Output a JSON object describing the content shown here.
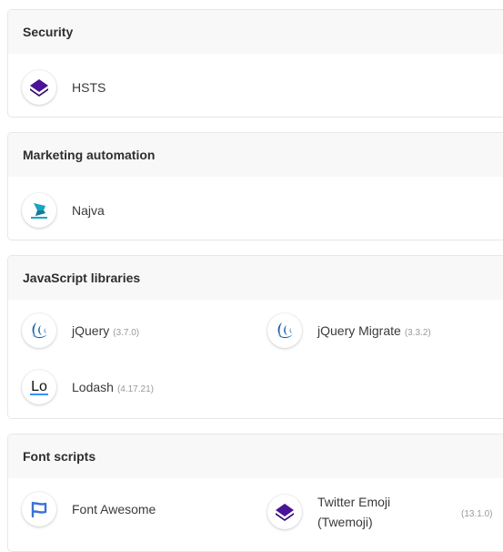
{
  "sections": [
    {
      "title": "Security",
      "items": [
        {
          "name": "HSTS",
          "version": "",
          "icon": "hsts-icon"
        }
      ]
    },
    {
      "title": "Marketing automation",
      "items": [
        {
          "name": "Najva",
          "version": "",
          "icon": "najva-icon"
        }
      ]
    },
    {
      "title": "JavaScript libraries",
      "items": [
        {
          "name": "jQuery",
          "version": "(3.7.0)",
          "icon": "jquery-icon"
        },
        {
          "name": "jQuery Migrate",
          "version": "(3.3.2)",
          "icon": "jquery-icon"
        },
        {
          "name": "Lodash",
          "version": "(4.17.21)",
          "icon": "lodash-icon"
        }
      ]
    },
    {
      "title": "Font scripts",
      "items": [
        {
          "name": "Font Awesome",
          "version": "",
          "icon": "font-awesome-icon"
        },
        {
          "name_line1": "Twitter Emoji",
          "name_line2": "(Twemoji)",
          "version": "(13.1.0)",
          "icon": "twemoji-icon"
        }
      ]
    }
  ],
  "colors": {
    "header_bg": "#f8f8f9",
    "border": "#e7e7e7",
    "diamond_dark": "#4a1496",
    "jquery_blue": "#1e63a6",
    "fontawesome_blue": "#3b72d4",
    "najva_teal": "#1aa3c2"
  }
}
